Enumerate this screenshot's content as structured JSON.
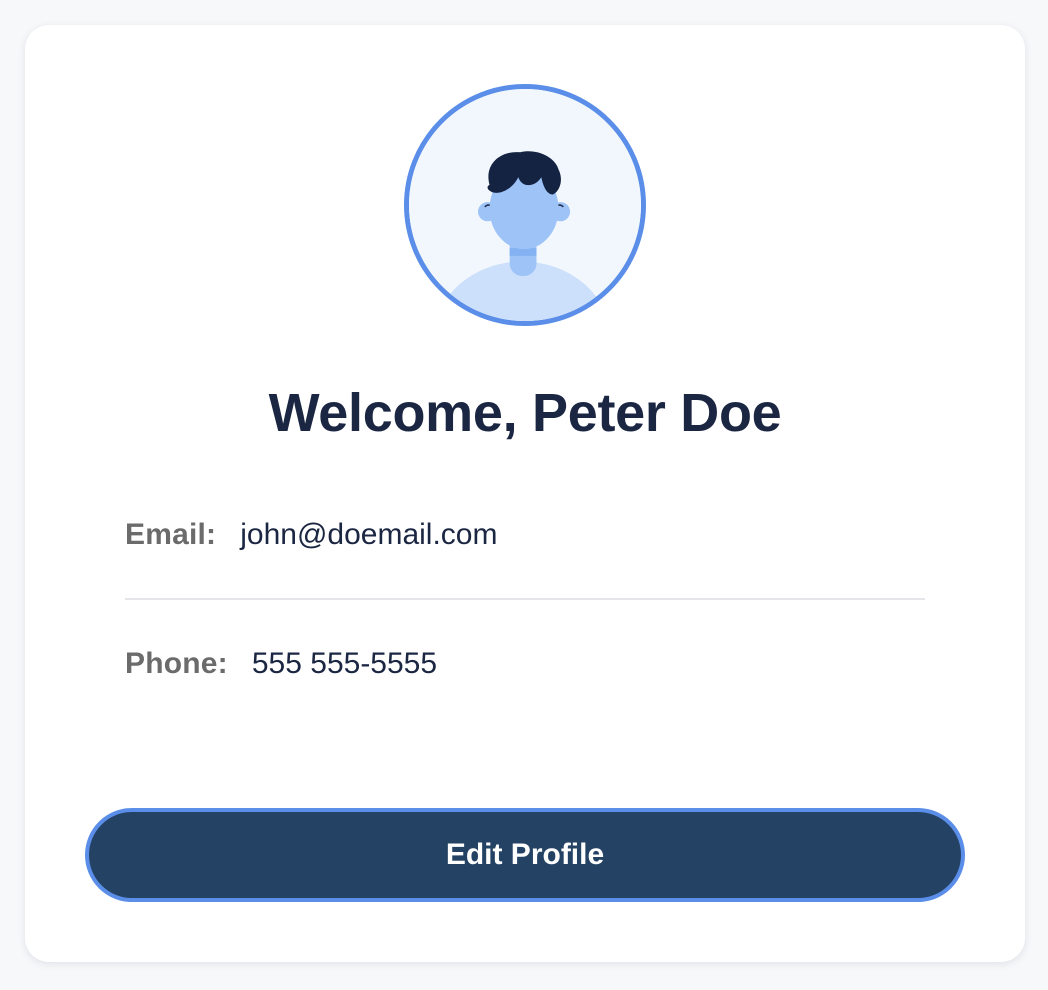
{
  "profile": {
    "welcome": "Welcome, Peter Doe",
    "email_label": "Email:",
    "email_value": "john@doemail.com",
    "phone_label": "Phone:",
    "phone_value": "555 555-5555",
    "edit_button_label": "Edit Profile"
  },
  "colors": {
    "page_background": "#f7f8fa",
    "card_background": "#ffffff",
    "accent_blue": "#5a8ee8",
    "button_background": "#244264",
    "heading_text": "#1b2642",
    "label_text": "#6b6b6b"
  },
  "icons": {
    "avatar": "user-avatar-icon"
  }
}
